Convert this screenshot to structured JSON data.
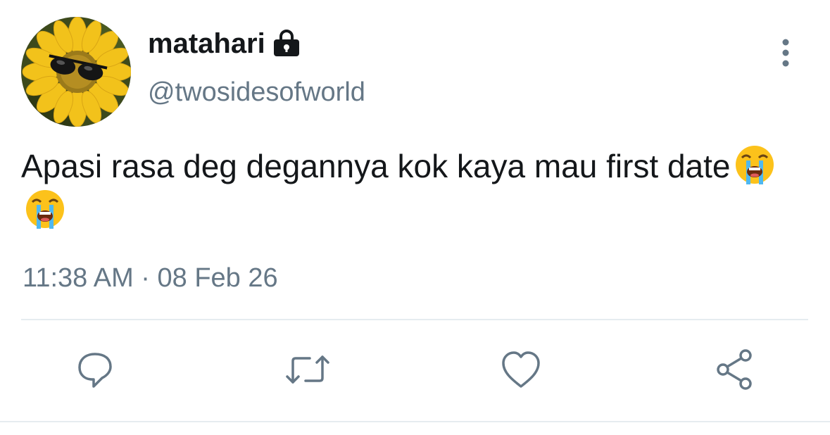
{
  "user": {
    "display_name": "matahari",
    "handle": "@twosidesofworld",
    "avatar_icon": "sunflower-with-sunglasses-avatar",
    "protected_icon": "lock-icon"
  },
  "tweet": {
    "text": "Apasi rasa deg degannya kok kaya mau first date",
    "emojis": [
      "loudly-crying-face-emoji",
      "loudly-crying-face-emoji"
    ],
    "time": "11:38 AM",
    "separator": "·",
    "date": "08 Feb 26"
  },
  "actions": {
    "reply_icon": "reply-icon",
    "retweet_icon": "retweet-icon",
    "like_icon": "heart-icon",
    "share_icon": "share-icon",
    "more_icon": "more-vertical-icon"
  },
  "colors": {
    "text_primary": "#14171a",
    "text_secondary": "#657786",
    "icon": "#657786",
    "divider": "#e6ecf0"
  }
}
